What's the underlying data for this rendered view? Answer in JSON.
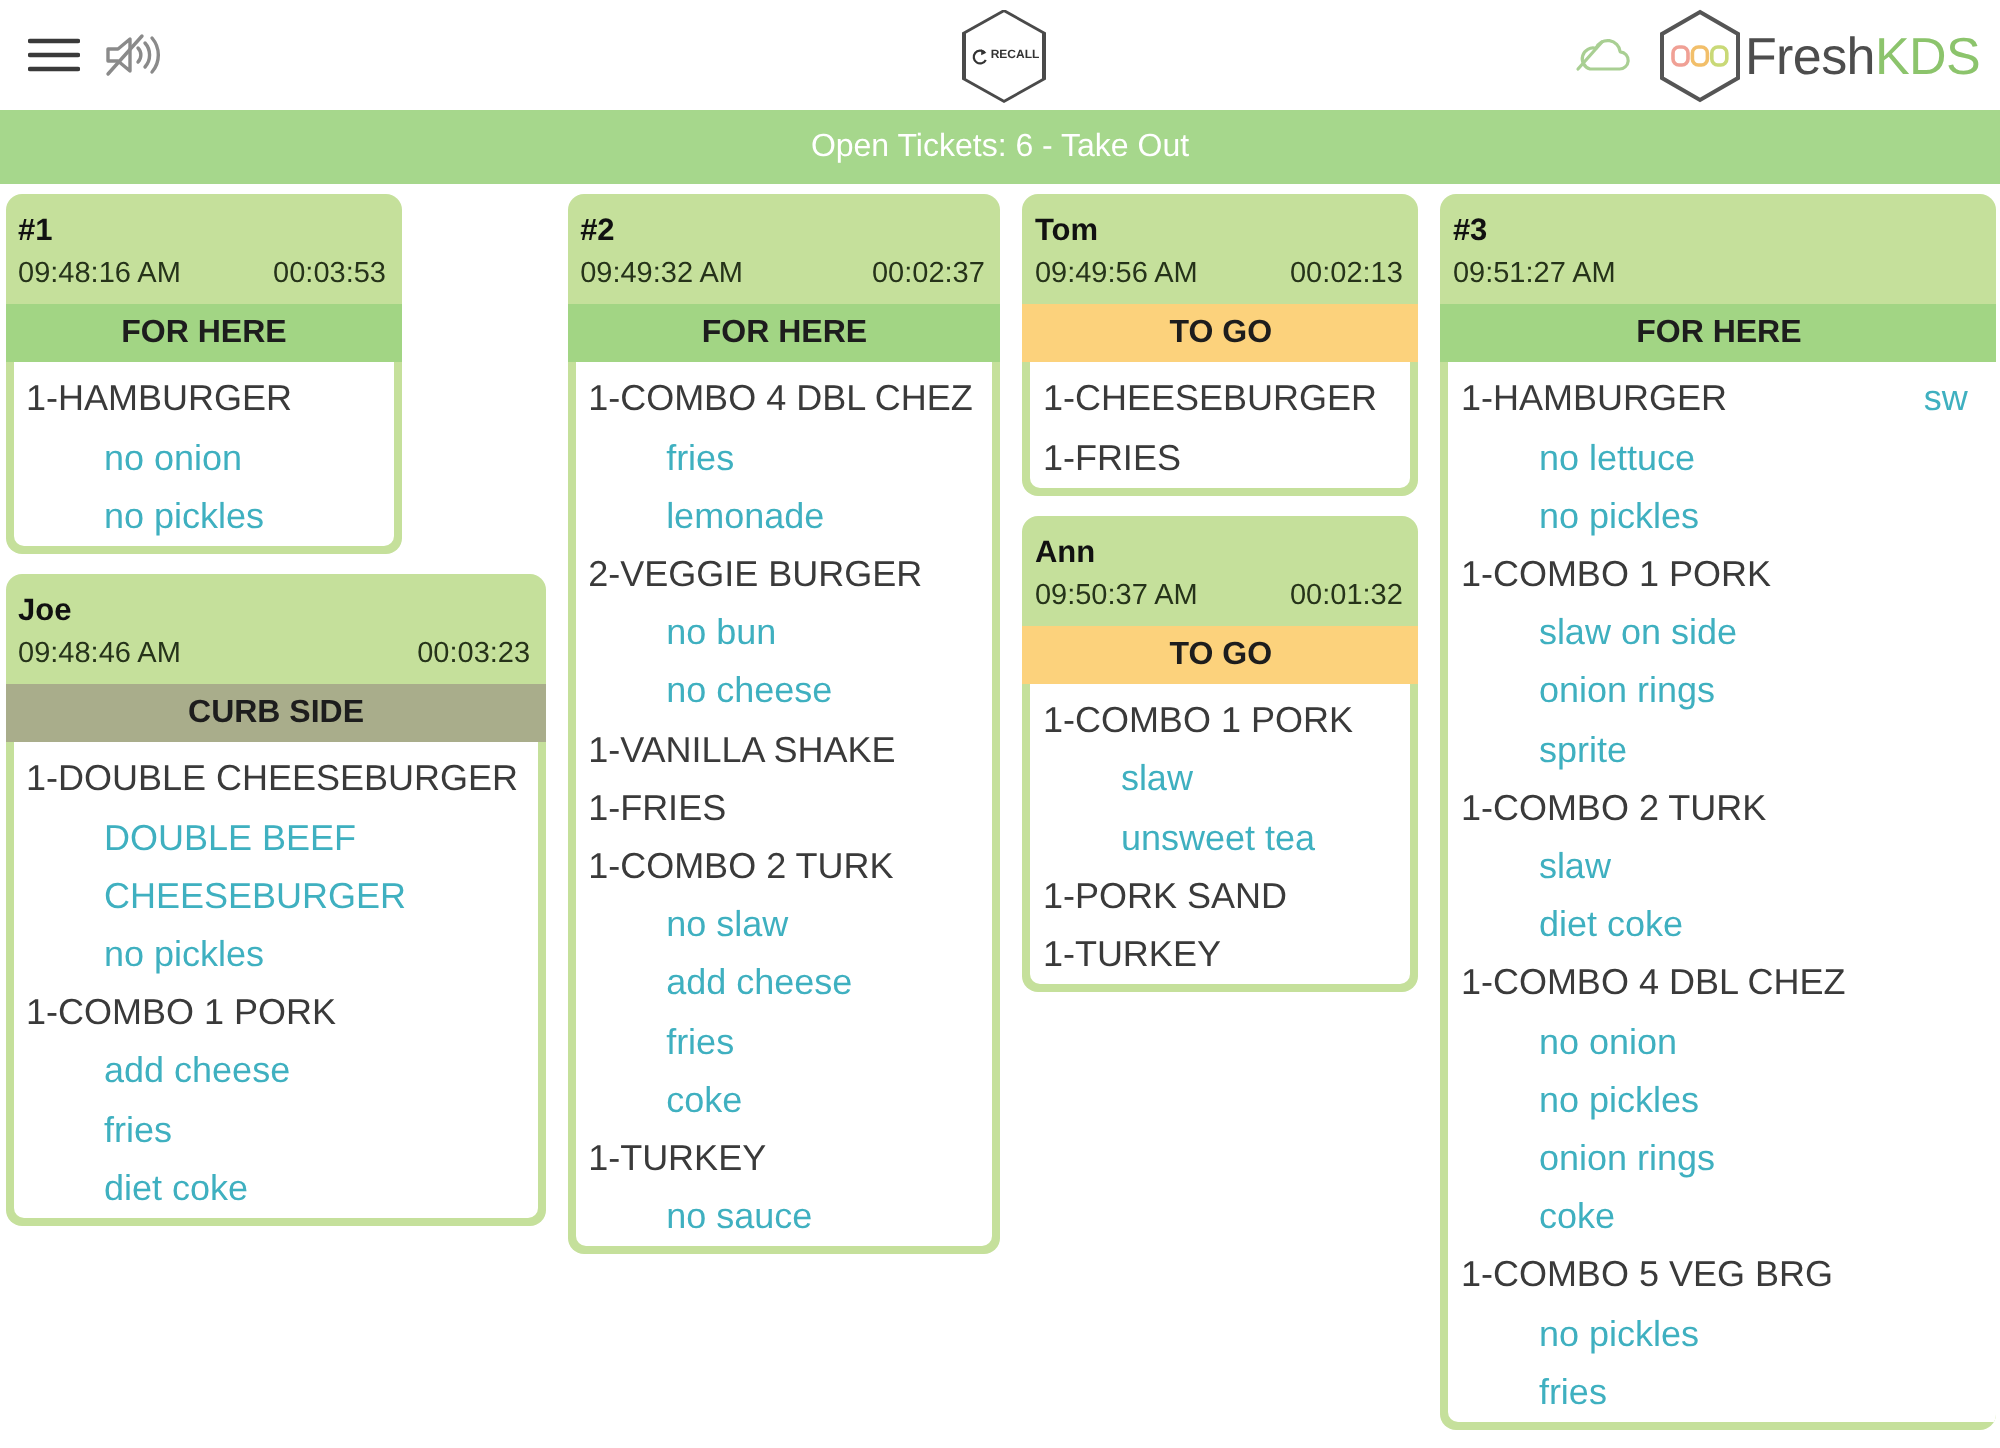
{
  "toolbar": {
    "recall_label": "RECALL"
  },
  "logo": {
    "text": "Fresh",
    "accent": "KDS"
  },
  "banner": {
    "text": "Open Tickets: 6 - Take Out"
  },
  "tickets": [
    {
      "title": "#1",
      "order_time": "09:48:16 AM",
      "elapsed": "00:03:53",
      "order_type": {
        "kind": "for_here",
        "label": "FOR HERE"
      },
      "items": [
        {
          "text": "1-HAMBURGER",
          "modifiers": [
            "no onion",
            "no pickles"
          ]
        }
      ]
    },
    {
      "title": "Joe",
      "order_time": "09:48:46 AM",
      "elapsed": "00:03:23",
      "order_type": {
        "kind": "curb_side",
        "label": "CURB SIDE"
      },
      "items": [
        {
          "text": "1-DOUBLE CHEESEBURGER",
          "modifiers": [
            "DOUBLE BEEF CHEESEBURGER",
            "no pickles"
          ]
        },
        {
          "text": "1-COMBO 1 PORK",
          "modifiers": [
            "add cheese",
            "fries",
            "diet coke"
          ]
        }
      ]
    },
    {
      "title": "#2",
      "order_time": "09:49:32 AM",
      "elapsed": "00:02:37",
      "order_type": {
        "kind": "for_here",
        "label": "FOR HERE"
      },
      "items": [
        {
          "text": "1-COMBO 4 DBL CHEZ",
          "modifiers": [
            "fries",
            "lemonade"
          ]
        },
        {
          "text": "2-VEGGIE BURGER",
          "modifiers": [
            "no bun",
            "no cheese"
          ]
        },
        {
          "text": "1-VANILLA SHAKE"
        },
        {
          "text": "1-FRIES"
        },
        {
          "text": "1-COMBO 2 TURK",
          "modifiers": [
            "no slaw",
            "add cheese",
            "fries",
            "coke"
          ]
        },
        {
          "text": "1-TURKEY",
          "modifiers": [
            "no sauce"
          ]
        }
      ]
    },
    {
      "title": "Tom",
      "order_time": "09:49:56 AM",
      "elapsed": "00:02:13",
      "order_type": {
        "kind": "to_go",
        "label": "TO GO"
      },
      "items": [
        {
          "text": "1-CHEESEBURGER"
        },
        {
          "text": "1-FRIES"
        }
      ]
    },
    {
      "title": "Ann",
      "order_time": "09:50:37 AM",
      "elapsed": "00:01:32",
      "order_type": {
        "kind": "to_go",
        "label": "TO GO"
      },
      "items": [
        {
          "text": "1-COMBO 1 PORK",
          "modifiers": [
            "slaw",
            "unsweet tea"
          ]
        },
        {
          "text": "1-PORK SAND"
        },
        {
          "text": "1-TURKEY"
        }
      ]
    },
    {
      "title": "#3",
      "order_time": "09:51:27 AM",
      "order_type": {
        "kind": "for_here",
        "label": "FOR HERE"
      },
      "items": [
        {
          "text": "1-HAMBURGER",
          "modifiers": [
            "no lettuce",
            "no pickles"
          ]
        },
        {
          "text": "1-COMBO 1 PORK",
          "modifiers": [
            "slaw on side",
            "onion rings",
            "sprite"
          ]
        },
        {
          "text": "1-COMBO 2 TURK",
          "modifiers": [
            "slaw",
            "diet coke"
          ]
        },
        {
          "text": "1-COMBO 4 DBL CHEZ",
          "modifiers": [
            "no onion",
            "no pickles",
            "onion rings",
            "coke"
          ]
        },
        {
          "text": "1-COMBO 5 VEG BRG",
          "modifiers": [
            "no pickles",
            "fries",
            "sw"
          ]
        }
      ]
    }
  ]
}
